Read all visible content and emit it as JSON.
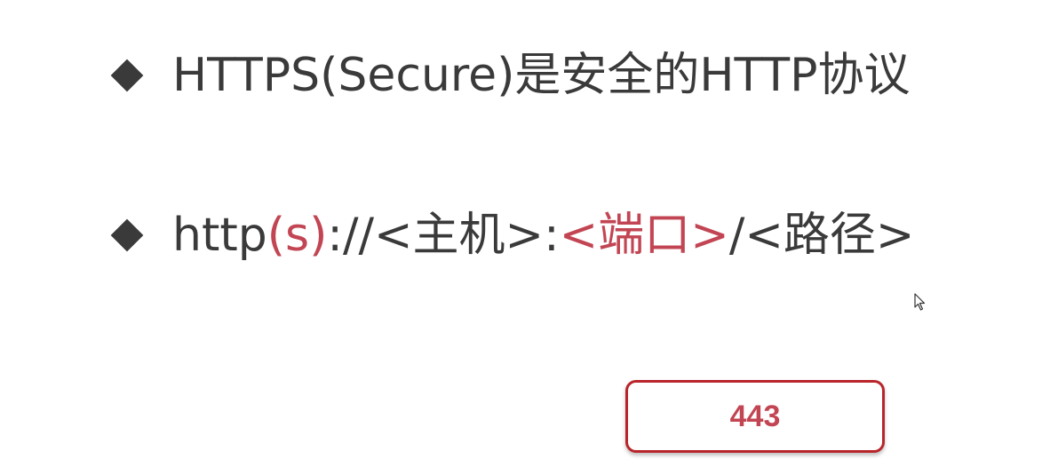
{
  "bullets": [
    {
      "parts": [
        {
          "text": "HTTPS(Secure)是安全的HTTP协议",
          "accent": false
        }
      ]
    },
    {
      "parts": [
        {
          "text": "http",
          "accent": false
        },
        {
          "text": "(s)",
          "accent": true
        },
        {
          "text": "://<主机>:",
          "accent": false
        },
        {
          "text": "<端口>",
          "accent": true
        },
        {
          "text": "/<路径>",
          "accent": false
        }
      ]
    }
  ],
  "answer_box": {
    "value": "443"
  },
  "colors": {
    "text": "#3a3a3a",
    "accent": "#c24553",
    "box_border": "#b8262b"
  },
  "icons": [
    "diamond-bullet-icon",
    "mouse-cursor-icon"
  ]
}
